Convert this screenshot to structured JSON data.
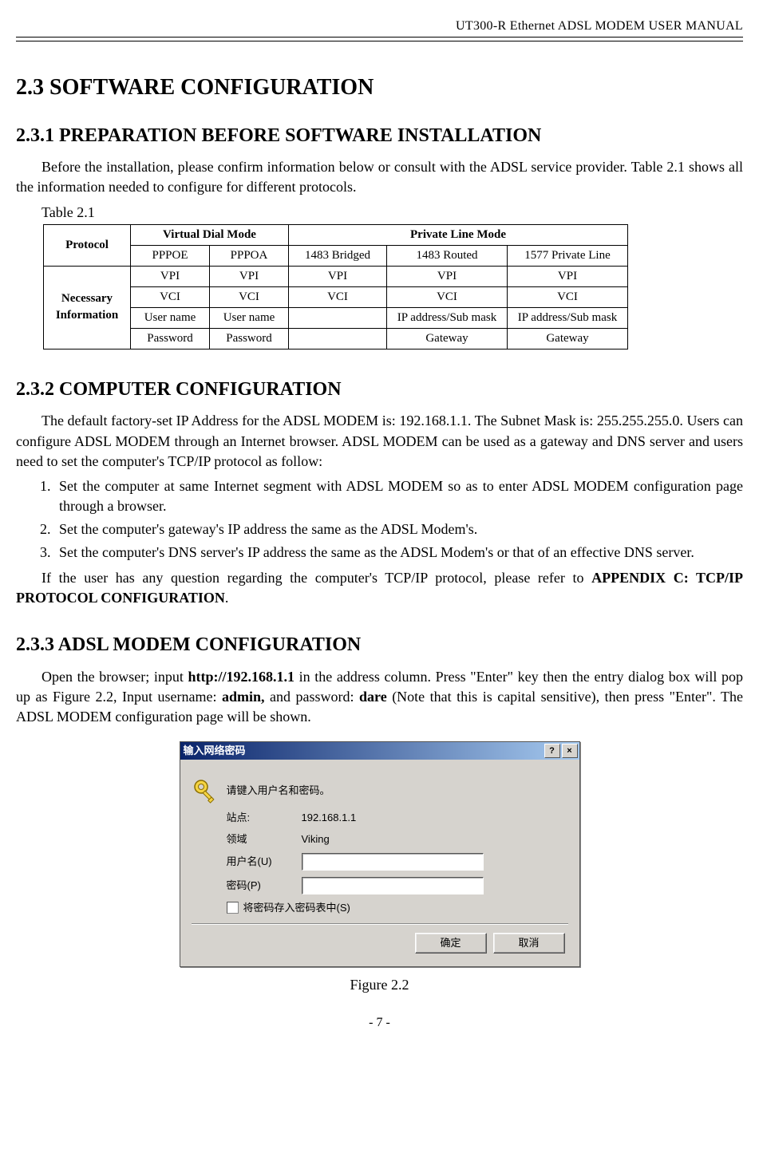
{
  "header": "UT300-R Ethernet ADSL MODEM USER MANUAL",
  "h1": "2.3 SOFTWARE CONFIGURATION",
  "s231": {
    "title": "2.3.1 PREPARATION BEFORE SOFTWARE INSTALLATION",
    "p1": "Before the installation, please confirm information below or consult with the ADSL service provider. Table 2.1 shows all the information needed to configure for different protocols.",
    "table_label": "Table 2.1",
    "table": {
      "row_protocol": "Protocol",
      "virtual_dial": "Virtual Dial Mode",
      "private_line": "Private Line Mode",
      "cols": [
        "PPPOE",
        "PPPOA",
        "1483 Bridged",
        "1483 Routed",
        "1577 Private Line"
      ],
      "row_necessary": "Necessary Information",
      "r1": [
        "VPI",
        "VPI",
        "VPI",
        "VPI",
        "VPI"
      ],
      "r2": [
        "VCI",
        "VCI",
        "VCI",
        "VCI",
        "VCI"
      ],
      "r3": [
        "User name",
        "User name",
        "",
        "IP address/Sub mask",
        "IP address/Sub mask"
      ],
      "r4": [
        "Password",
        "Password",
        "",
        "Gateway",
        "Gateway"
      ]
    }
  },
  "s232": {
    "title": "2.3.2 COMPUTER CONFIGURATION",
    "p1": "The default factory-set IP Address for the ADSL MODEM is: 192.168.1.1. The Subnet Mask is: 255.255.255.0. Users can configure ADSL MODEM through an Internet browser. ADSL MODEM can be used as a gateway and DNS server and users need to set the computer's TCP/IP protocol as follow:",
    "li1": "Set the computer at same Internet segment with ADSL MODEM so as to enter ADSL MODEM configuration page through a browser.",
    "li2": "Set the computer's gateway's IP address the same as the ADSL Modem's.",
    "li3": "Set the computer's DNS server's IP address the same as the ADSL Modem's or that of an effective DNS server.",
    "p2a": "If the user has any question regarding the computer's TCP/IP protocol, please refer to ",
    "p2b": "APPENDIX C: TCP/IP PROTOCOL CONFIGURATION",
    "p2c": "."
  },
  "s233": {
    "title": "2.3.3 ADSL MODEM CONFIGURATION",
    "p1a": "Open the browser; input ",
    "p1b": "http://192.168.1.1",
    "p1c": " in the address column. Press \"Enter\" key then the entry dialog box will pop up as Figure 2.2, Input username: ",
    "p1d": "admin,",
    "p1e": " and password: ",
    "p1f": "dare",
    "p1g": "  (Note that this is capital sensitive), then press \"Enter\".  The ADSL MODEM configuration page will be shown."
  },
  "dialog": {
    "title": "输入网络密码",
    "prompt": "请键入用户名和密码。",
    "site_label": "站点:",
    "site_value": "192.168.1.1",
    "realm_label": "领域",
    "realm_value": "Viking",
    "user_label": "用户名(U)",
    "pass_label": "密码(P)",
    "save_label": "将密码存入密码表中(S)",
    "ok": "确定",
    "cancel": "取消",
    "help_btn": "?",
    "close_btn": "×"
  },
  "figure_caption": "Figure 2.2",
  "footer": "- 7 -"
}
